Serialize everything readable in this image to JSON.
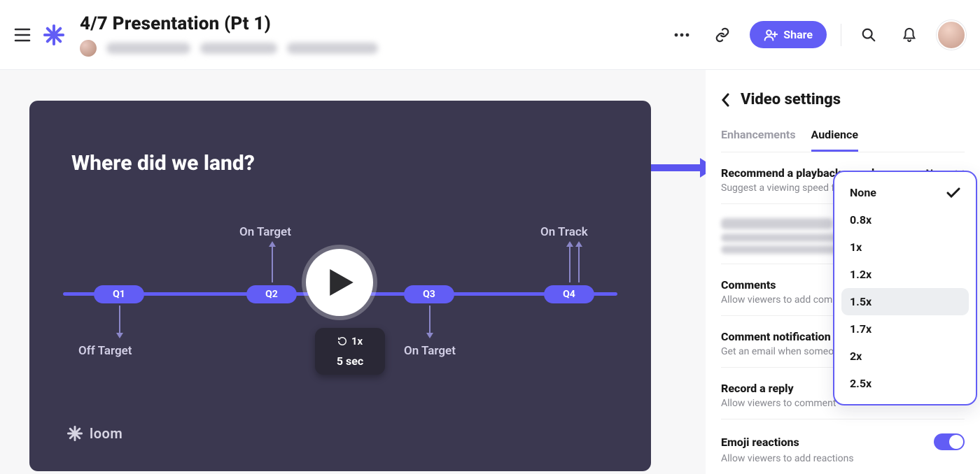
{
  "header": {
    "title": "4/7 Presentation (Pt 1)",
    "share_label": "Share"
  },
  "video": {
    "slide_title": "Where did we land?",
    "nodes": [
      "Q1",
      "Q2",
      "Q3",
      "Q4"
    ],
    "labels": {
      "q1": "Off Target",
      "q2": "On Target",
      "q3": "On Target",
      "q4": "On Track"
    },
    "speed_indicator": "1x",
    "duration_chip": "5 sec",
    "watermark": "loom"
  },
  "sidebar": {
    "panel_title": "Video settings",
    "tabs": {
      "enhancements": "Enhancements",
      "audience": "Audience"
    },
    "playback": {
      "title": "Recommend a playback speed",
      "desc": "Suggest a viewing speed fo",
      "selected": "None",
      "options": [
        "None",
        "0.8x",
        "1x",
        "1.2x",
        "1.5x",
        "1.7x",
        "2x",
        "2.5x"
      ]
    },
    "comments": {
      "title": "Comments",
      "desc": "Allow viewers to add comm"
    },
    "comment_notif": {
      "title": "Comment notification",
      "desc": "Get an email when someon"
    },
    "record_reply": {
      "title": "Record a reply",
      "desc": "Allow viewers to comment"
    },
    "emoji": {
      "title": "Emoji reactions",
      "desc": "Allow viewers to add reactions"
    }
  }
}
